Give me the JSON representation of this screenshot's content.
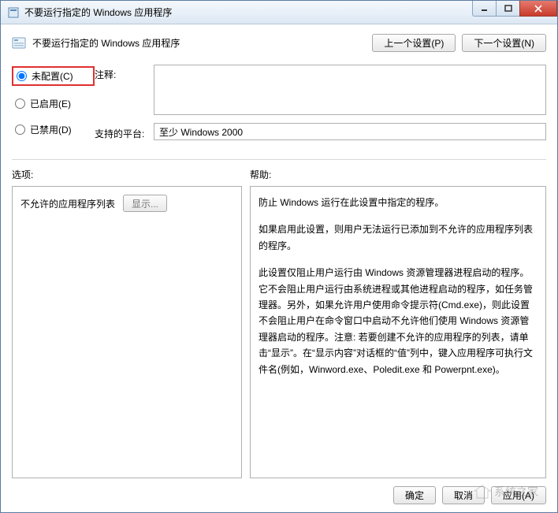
{
  "window": {
    "title": "不要运行指定的 Windows 应用程序"
  },
  "header": {
    "title": "不要运行指定的 Windows 应用程序",
    "prev_btn": "上一个设置(P)",
    "next_btn": "下一个设置(N)"
  },
  "radios": {
    "not_configured": "未配置(C)",
    "enabled": "已启用(E)",
    "disabled": "已禁用(D)",
    "selected": "not_configured"
  },
  "fields": {
    "comment_label": "注释:",
    "comment_value": "",
    "platform_label": "支持的平台:",
    "platform_value": "至少 Windows 2000"
  },
  "section_labels": {
    "options": "选项:",
    "help": "帮助:"
  },
  "options_pane": {
    "list_label": "不允许的应用程序列表",
    "show_btn": "显示..."
  },
  "help_pane": {
    "p1": "防止 Windows 运行在此设置中指定的程序。",
    "p2": "如果启用此设置，则用户无法运行已添加到不允许的应用程序列表的程序。",
    "p3": "此设置仅阻止用户运行由 Windows 资源管理器进程启动的程序。它不会阻止用户运行由系统进程或其他进程启动的程序，如任务管理器。另外，如果允许用户使用命令提示符(Cmd.exe)，则此设置不会阻止用户在命令窗口中启动不允许他们使用 Windows 资源管理器启动的程序。注意: 若要创建不允许的应用程序的列表，请单击“显示”。在“显示内容”对话框的“值”列中，键入应用程序可执行文件名(例如，Winword.exe、Poledit.exe 和 Powerpnt.exe)。"
  },
  "footer": {
    "ok": "确定",
    "cancel": "取消",
    "apply": "应用(A)"
  },
  "watermark": "系统之家"
}
